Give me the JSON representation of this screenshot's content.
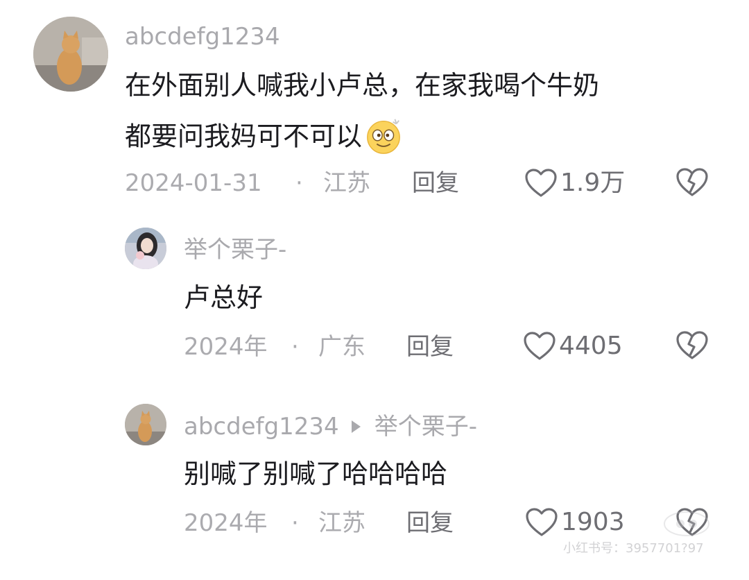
{
  "comments": [
    {
      "username": "abcdefg1234",
      "text_line1": "在外面别人喊我小卢总，在家我喝个牛奶",
      "text_line2": "都要问我妈可不可以",
      "date": "2024-01-31",
      "location": "江苏",
      "separator": "·",
      "reply_label": "回复",
      "likes": "1.9万"
    },
    {
      "username": "举个栗子-",
      "text": "卢总好",
      "date": "2024年",
      "location": "广东",
      "separator": "·",
      "reply_label": "回复",
      "likes": "4405"
    },
    {
      "username": "abcdefg1234",
      "reply_to": "举个栗子-",
      "text": "别喊了别喊了哈哈哈哈",
      "date": "2024年",
      "location": "江苏",
      "separator": "·",
      "reply_label": "回复",
      "likes": "1903"
    }
  ],
  "watermark": "小红书号：3957701?97",
  "icons": {
    "like": "heart-outline-icon",
    "dislike": "broken-heart-icon",
    "emoji": "dizzy-face-emoji-icon",
    "reply_arrow": "triangle-right-icon"
  },
  "colors": {
    "username": "#a9a9ad",
    "text": "#1b1b1f",
    "meta": "#ababaf",
    "action": "#6e6e73"
  }
}
